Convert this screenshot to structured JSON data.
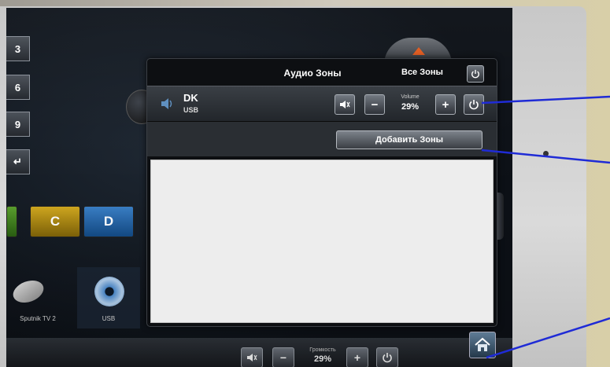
{
  "left_keypad": {
    "keys": [
      "3",
      "6",
      "9",
      "↵"
    ]
  },
  "color_keys": {
    "c_label": "C",
    "d_label": "D"
  },
  "sources": {
    "tv_label": "Sputnik TV 2",
    "usb_label": "USB"
  },
  "popup": {
    "title": "Аудио Зоны",
    "all_zones_label": "Все Зоны",
    "zone": {
      "name": "DK",
      "source": "USB",
      "volume_label": "Volume",
      "volume_value": "29%"
    },
    "add_zones_label": "Добавить Зоны"
  },
  "bottom_bar": {
    "volume_label": "Громкость",
    "volume_value": "29%",
    "minus_label": "−",
    "plus_label": "+"
  },
  "icons": {
    "power": "power-icon",
    "speaker": "speaker-icon",
    "mute": "mute-icon",
    "home": "home-icon"
  },
  "colors": {
    "callout_line": "#1f2bd6",
    "accent_orange": "#e05a1e"
  }
}
